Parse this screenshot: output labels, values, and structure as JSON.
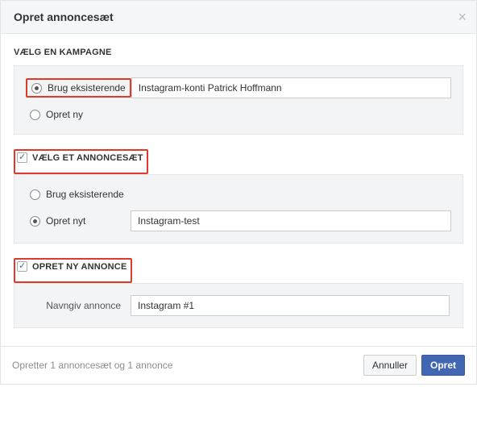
{
  "dialog": {
    "title": "Opret annoncesæt"
  },
  "campaign": {
    "section_label": "VÆLG EN KAMPAGNE",
    "use_existing_label": "Brug eksisterende",
    "create_new_label": "Opret ny",
    "existing_value": "Instagram-konti Patrick Hoffmann"
  },
  "adset": {
    "section_label": "VÆLG ET ANNONCESÆT",
    "use_existing_label": "Brug eksisterende",
    "create_new_label": "Opret nyt",
    "new_value": "Instagram-test"
  },
  "ad": {
    "section_label": "OPRET NY ANNONCE",
    "name_label": "Navngiv annonce",
    "name_value": "Instagram #1"
  },
  "footer": {
    "status": "Opretter 1 annoncesæt og 1 annonce",
    "cancel": "Annuller",
    "submit": "Opret"
  }
}
